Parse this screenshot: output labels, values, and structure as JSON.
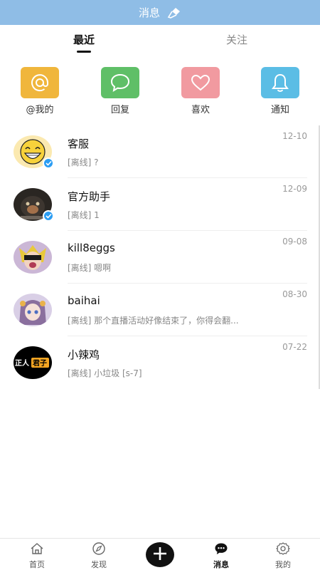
{
  "header": {
    "title": "消息",
    "icon": "broom-icon"
  },
  "tabs": [
    {
      "label": "最近",
      "active": true
    },
    {
      "label": "关注",
      "active": false
    }
  ],
  "quick_actions": [
    {
      "label": "@我的",
      "icon": "at-icon",
      "color": "#f0b63c"
    },
    {
      "label": "回复",
      "icon": "chat-bubble-icon",
      "color": "#5fbf67"
    },
    {
      "label": "喜欢",
      "icon": "heart-icon",
      "color": "#f19aa0"
    },
    {
      "label": "通知",
      "icon": "bell-icon",
      "color": "#5bbde5"
    }
  ],
  "conversations": [
    {
      "name": "客服",
      "message": "[离线] ?",
      "date": "12-10",
      "verified": true
    },
    {
      "name": "官方助手",
      "message": "[离线] 1",
      "date": "12-09",
      "verified": true
    },
    {
      "name": "kill8eggs",
      "message": "[离线] 嗯啊",
      "date": "09-08",
      "verified": false
    },
    {
      "name": "baihai",
      "message": "[离线] 那个直播活动好像结束了，你得会翻...",
      "date": "08-30",
      "verified": false
    },
    {
      "name": "小辣鸡",
      "message": "[离线] 小垃圾 [s-7]",
      "date": "07-22",
      "verified": false,
      "avatar_text": [
        "正人",
        "君子"
      ]
    }
  ],
  "bottom_nav": [
    {
      "label": "首页",
      "icon": "home-icon",
      "active": false
    },
    {
      "label": "发现",
      "icon": "compass-icon",
      "active": false
    },
    {
      "label": "",
      "icon": "plus-icon",
      "active": false
    },
    {
      "label": "消息",
      "icon": "message-icon",
      "active": true
    },
    {
      "label": "我的",
      "icon": "gear-icon",
      "active": false
    }
  ],
  "colors": {
    "header_bg": "#8fbde6",
    "verified": "#2b9df3"
  }
}
